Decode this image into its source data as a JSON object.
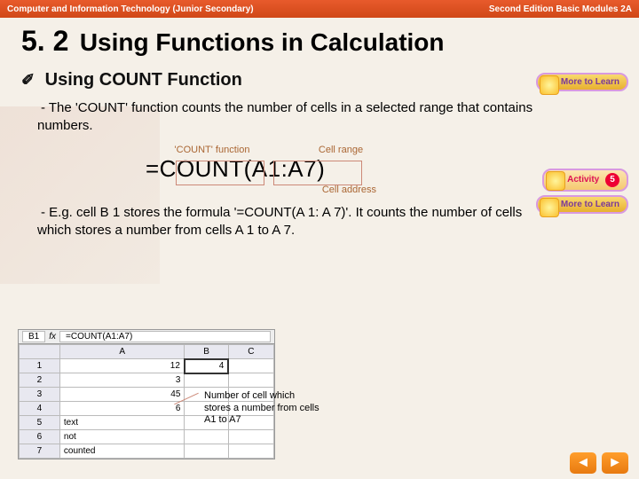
{
  "topbar": {
    "left": "Computer and Information Technology (Junior Secondary)",
    "right": "Second Edition Basic Modules 2A"
  },
  "section": {
    "num": "5. 2",
    "title": "Using Functions in Calculation"
  },
  "sub": {
    "bullet": "✐",
    "text": "Using COUNT Function"
  },
  "p1": "- The 'COUNT' function counts the number of cells in a selected range that contains numbers.",
  "formula": {
    "lbl1": "'COUNT' function",
    "lbl2": "Cell range",
    "text": "=COUNT(A1:A7)",
    "sub": "Cell address"
  },
  "p2": "- E.g. cell B 1 stores the formula '=COUNT(A 1: A 7)'. It counts the number of cells which stores a number from cells A 1 to A 7.",
  "sheet": {
    "cellref": "B1",
    "fx": "=COUNT(A1:A7)",
    "cols": [
      "",
      "A",
      "B",
      "C"
    ],
    "rows": [
      [
        "1",
        "12",
        "4",
        ""
      ],
      [
        "2",
        "3",
        "",
        ""
      ],
      [
        "3",
        "45",
        "",
        ""
      ],
      [
        "4",
        "6",
        "",
        ""
      ],
      [
        "5",
        "text",
        "",
        ""
      ],
      [
        "6",
        "not",
        "",
        ""
      ],
      [
        "7",
        "counted",
        "",
        ""
      ]
    ]
  },
  "annot": "Number of cell which stores a number from cells A1 to A7",
  "badges": {
    "more": "More to Learn",
    "activity": "Activity",
    "actnum": "5"
  },
  "nav": {
    "prev": "◄",
    "next": "►"
  }
}
